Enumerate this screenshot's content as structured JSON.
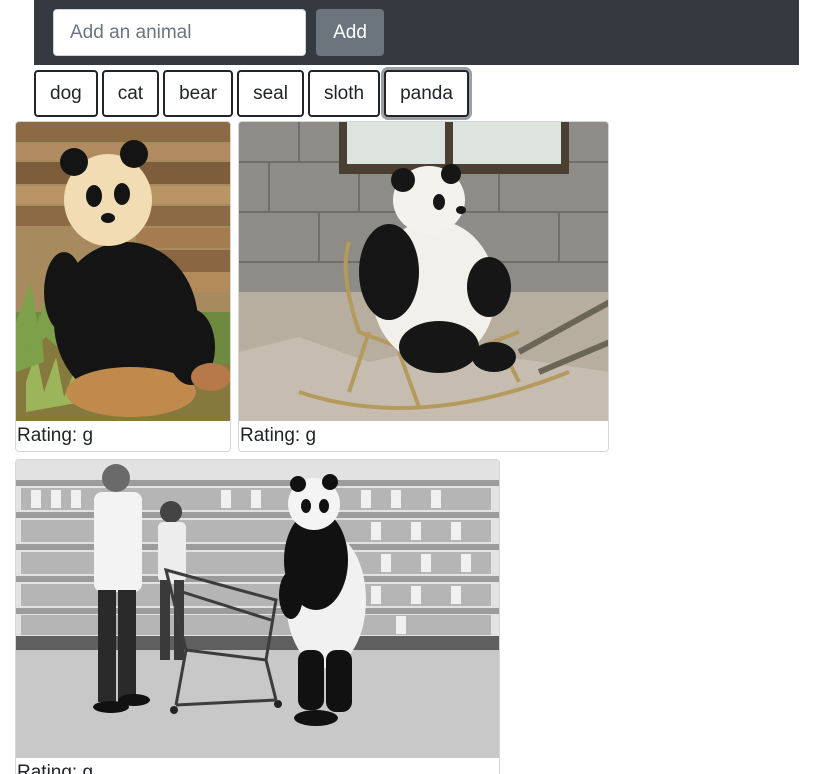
{
  "navbar": {
    "input": {
      "placeholder": "Add an animal",
      "value": ""
    },
    "add_label": "Add"
  },
  "animal_buttons": [
    {
      "label": "dog",
      "active": false
    },
    {
      "label": "cat",
      "active": false
    },
    {
      "label": "bear",
      "active": false
    },
    {
      "label": "seal",
      "active": false
    },
    {
      "label": "sloth",
      "active": false
    },
    {
      "label": "panda",
      "active": true
    }
  ],
  "gifs": [
    {
      "rating": "Rating: g",
      "icon": "panda-sitting-on-logs-image"
    },
    {
      "rating": "Rating: g",
      "icon": "panda-in-rocking-chair-image"
    },
    {
      "rating": "Rating: g",
      "icon": "panda-costume-in-supermarket-image"
    }
  ],
  "colors": {
    "navbar": "#343a40",
    "add_button": "#6c757d",
    "button_border": "#212529"
  }
}
